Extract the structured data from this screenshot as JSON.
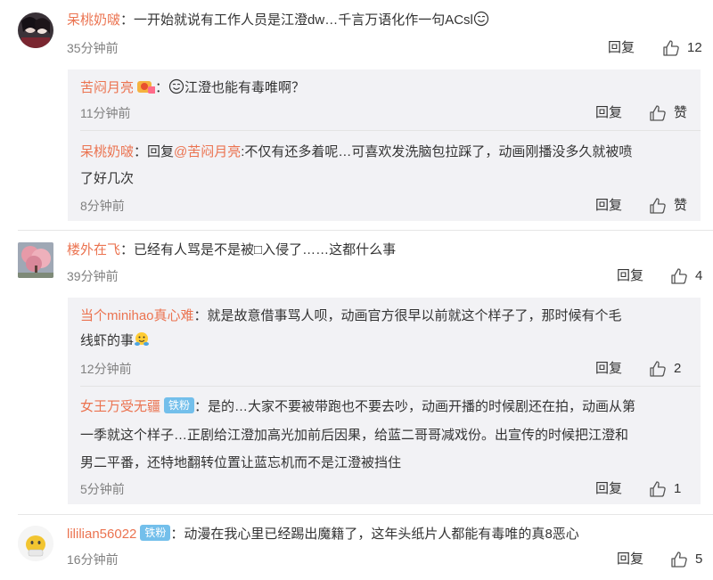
{
  "reply_label": "回复",
  "comments": [
    {
      "user": "呆桃奶啵",
      "text": "：一开始就说有工作人员是江澄dw…千言万语化作一句ACsl",
      "time": "35分钟前",
      "likes": "12",
      "replies": [
        {
          "user": "苦闷月亮",
          "text": "：",
          "text2": "江澄也能有毒唯啊？",
          "time": "11分钟前",
          "likes": "赞"
        },
        {
          "user": "呆桃奶啵",
          "text": "：回复",
          "mention": "@苦闷月亮",
          "text2": ":不仅有还多着呢…可喜欢发洗脑包拉踩了，动画刚播没多久就被喷",
          "text3": "了好几次",
          "time": "8分钟前",
          "likes": "赞"
        }
      ]
    },
    {
      "user": "楼外在飞",
      "text": "：已经有人骂是不是被□入侵了……这都什么事",
      "time": "39分钟前",
      "likes": "4",
      "replies": [
        {
          "user": "当个minihao真心难",
          "text": "：就是故意借事骂人呗，动画官方很早以前就这个样子了，那时候有个毛",
          "text2": "线虾的事",
          "time": "12分钟前",
          "likes": "2"
        },
        {
          "user": "女王万受无疆",
          "badge": "铁粉",
          "text": "：是的…大家不要被带跑也不要去吵，动画开播的时候剧还在拍，动画从第",
          "text2": "一季就这个样子…正剧给江澄加高光加前后因果，给蓝二哥哥减戏份。出宣传的时候把江澄和",
          "text3": "男二平番，还特地翻转位置让蓝忘机而不是江澄被挡住",
          "time": "5分钟前",
          "likes": "1"
        }
      ]
    },
    {
      "user": "lililian56022",
      "badge": "铁粉",
      "text": "：动漫在我心里已经踢出魔籍了，这年头纸片人都能有毒唯的真",
      "text_tail": "恶心",
      "text_tail_prefix": "8",
      "time": "16分钟前",
      "likes": "5"
    }
  ]
}
